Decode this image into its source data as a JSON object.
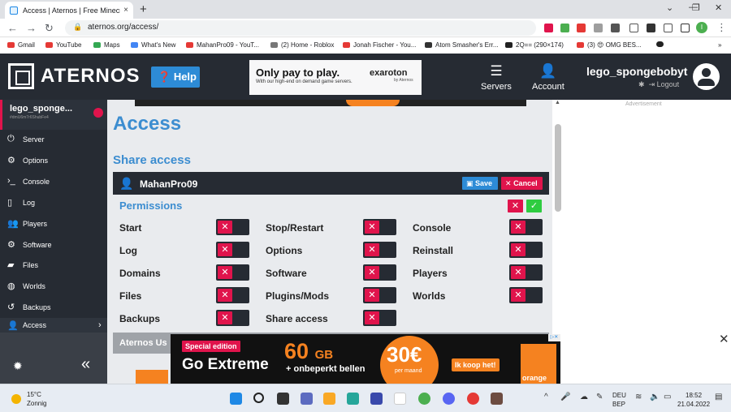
{
  "browser": {
    "tab_title": "Access | Aternos | Free Minecraft",
    "tab_close": "×",
    "new_tab": "+",
    "url": "aternos.org/access/",
    "profile_initial": "I",
    "bookmarks": [
      "Gmail",
      "YouTube",
      "Maps",
      "What's New",
      "MahanPro09 - YouT...",
      "(2) Home - Roblox",
      "Jonah Fischer - You...",
      "Atom Smasher's Err...",
      "2Q== (290×174)",
      "(3) 😍 OMG BES..."
    ]
  },
  "header": {
    "logo": "ATERNOS",
    "help": "Help",
    "ad": {
      "headline": "Only pay to play.",
      "sub": "With our high-end on demand game servers.",
      "brand": "exaroton",
      "by": "by Aternos"
    },
    "servers": "Servers",
    "account": "Account",
    "username": "lego_spongebobyt",
    "logout": "Logout"
  },
  "sidebar": {
    "server_name": "lego_sponge...",
    "server_id": "#dmU6m7r6ShubFe4",
    "items": [
      {
        "label": "Server",
        "icon": "power-icon"
      },
      {
        "label": "Options",
        "icon": "sliders-icon"
      },
      {
        "label": "Console",
        "icon": "terminal-icon"
      },
      {
        "label": "Log",
        "icon": "file-icon"
      },
      {
        "label": "Players",
        "icon": "users-icon"
      },
      {
        "label": "Software",
        "icon": "gear-icon"
      },
      {
        "label": "Files",
        "icon": "folder-icon"
      },
      {
        "label": "Worlds",
        "icon": "globe-icon"
      },
      {
        "label": "Backups",
        "icon": "history-icon"
      },
      {
        "label": "Access",
        "icon": "user-lock-icon"
      }
    ],
    "collapse": "«"
  },
  "main": {
    "title": "Access",
    "share_title": "Share access",
    "user": "MahanPro09",
    "save": "Save",
    "cancel": "Cancel",
    "permissions_title": "Permissions",
    "permissions": [
      [
        "Start",
        "Stop/Restart",
        "Console"
      ],
      [
        "Log",
        "Options",
        "Reinstall"
      ],
      [
        "Domains",
        "Software",
        "Players"
      ],
      [
        "Files",
        "Plugins/Mods",
        "Worlds"
      ],
      [
        "Backups",
        "Share access",
        ""
      ]
    ],
    "next_section": "Aternos Us",
    "advertisement": "Advertisement"
  },
  "bottom_ad": {
    "special": "Special edition",
    "go_extreme": "Go Extreme",
    "gb": "60",
    "gb_unit": "GB",
    "unlimited": "+ onbeperkt bellen",
    "price": "30",
    "currency": "€",
    "per_month": "per maand",
    "buy": "Ik koop het!",
    "brand": "orange"
  },
  "taskbar": {
    "temp": "15°C",
    "weather": "Zonnig",
    "lang1": "DEU",
    "lang2": "BEP",
    "time": "18:52",
    "date": "21.04.2022"
  },
  "colors": {
    "accent": "#3c8dd0",
    "dark": "#262b33",
    "red": "#e0144c",
    "green": "#2ecc40",
    "orange": "#f58220"
  }
}
